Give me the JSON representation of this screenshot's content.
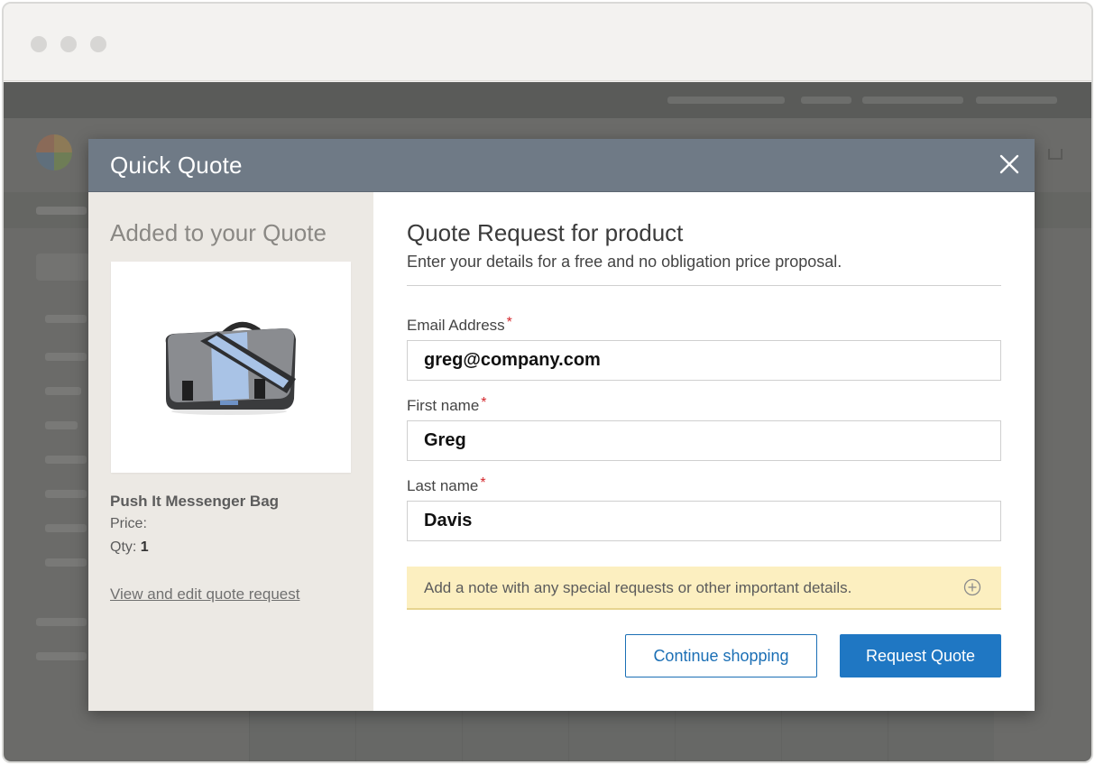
{
  "modal": {
    "title": "Quick Quote",
    "close_label": "close"
  },
  "left_panel": {
    "heading": "Added to your Quote",
    "product_name": "Push It Messenger Bag",
    "price_label": "Price:",
    "qty_label": "Qty:",
    "qty_value": "1",
    "edit_link": "View and edit quote request"
  },
  "form": {
    "title": "Quote Request for product",
    "subtitle": "Enter your details for a free and no obligation price proposal.",
    "required_mark": "*",
    "email": {
      "label": "Email Address",
      "value": "greg@company.com"
    },
    "first_name": {
      "label": "First name",
      "value": "Greg"
    },
    "last_name": {
      "label": "Last name",
      "value": "Davis"
    },
    "note_prompt": "Add a note with any special requests or other important details.",
    "continue_button": "Continue shopping",
    "request_button": "Request Quote"
  },
  "colors": {
    "header_bg": "#6f7a86",
    "primary": "#1f77c3",
    "note_bg": "#fcefc0",
    "required": "#d4282d"
  }
}
